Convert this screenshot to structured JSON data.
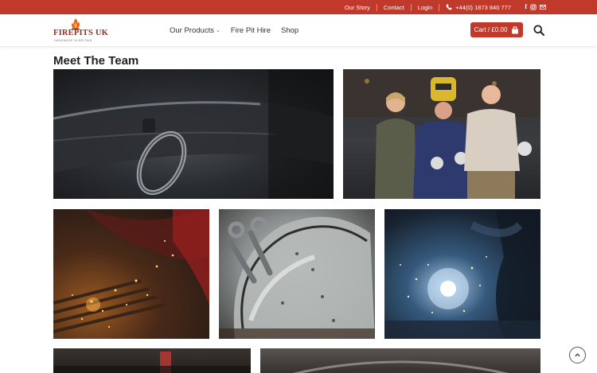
{
  "topbar": {
    "links": [
      "Our Story",
      "Contact",
      "Login"
    ],
    "phone": "+44(0) 1873 840 777",
    "social": [
      "facebook-icon",
      "instagram-icon",
      "email-icon"
    ]
  },
  "header": {
    "logo_name": "FIREPITS UK",
    "logo_tagline": "HANDMADE IN BRITAIN",
    "nav": [
      {
        "label": "Our Products",
        "has_dropdown": true
      },
      {
        "label": "Fire Pit Hire",
        "has_dropdown": false
      },
      {
        "label": "Shop",
        "has_dropdown": false
      }
    ],
    "cart_label": "Cart / £0.00"
  },
  "page": {
    "title": "Meet The Team"
  },
  "colors": {
    "brand_red": "#c0392b"
  }
}
